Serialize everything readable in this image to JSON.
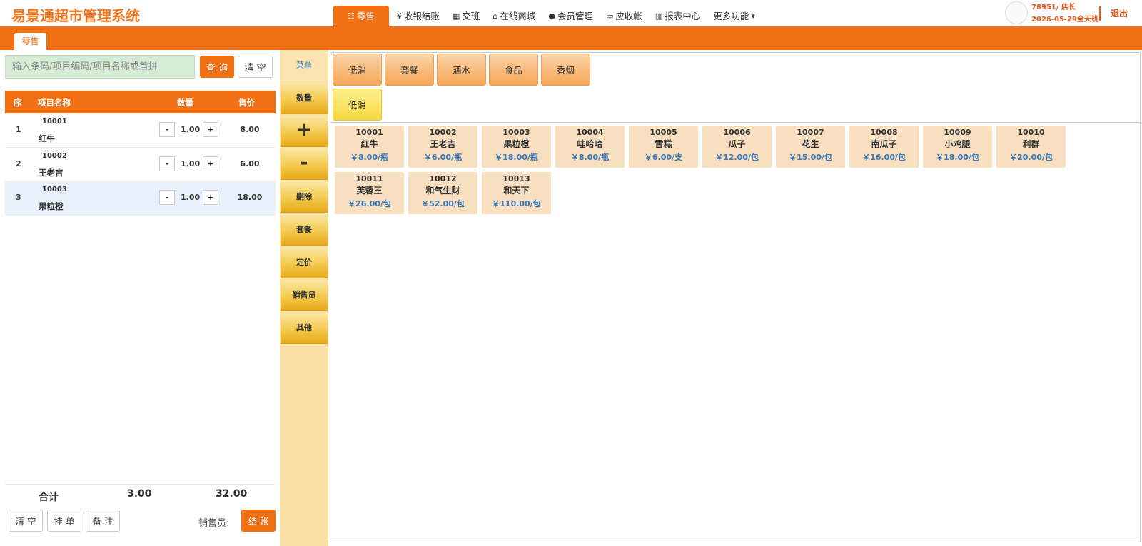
{
  "app": {
    "title": "易景通超市管理系统"
  },
  "nav": {
    "items": [
      {
        "label": "零售",
        "icon": "list-card-icon",
        "glyph": "☷"
      },
      {
        "label": "收银结账",
        "icon": "yen-icon",
        "glyph": "¥"
      },
      {
        "label": "交班",
        "icon": "calculator-icon",
        "glyph": "▦"
      },
      {
        "label": "在线商城",
        "icon": "basket-icon",
        "glyph": "⌂"
      },
      {
        "label": "会员管理",
        "icon": "user-icon",
        "glyph": "●"
      },
      {
        "label": "应收帐",
        "icon": "credit-card-icon",
        "glyph": "▭"
      },
      {
        "label": "报表中心",
        "icon": "bar-chart-icon",
        "glyph": "▥"
      },
      {
        "label": "更多功能",
        "icon": "caret-down-icon",
        "glyph": "▾"
      }
    ]
  },
  "user": {
    "name": "78951/ 店长",
    "date": "2026-05-29全天班",
    "logout": "退出"
  },
  "tabs": {
    "retail": "零售"
  },
  "search": {
    "placeholder": "输入条码/项目编码/项目名称或首拼",
    "query": "查 询",
    "clear": "清 空"
  },
  "cart": {
    "headers": {
      "idx": "序",
      "name": "项目名称",
      "qty": "数量",
      "price": "售价"
    },
    "rows": [
      {
        "idx": "1",
        "code": "10001",
        "name": "红牛",
        "qty": "1.00",
        "price": "8.00",
        "minus": "-",
        "plus": "+"
      },
      {
        "idx": "2",
        "code": "10002",
        "name": "王老吉",
        "qty": "1.00",
        "price": "6.00",
        "minus": "-",
        "plus": "+"
      },
      {
        "idx": "3",
        "code": "10003",
        "name": "果粒橙",
        "qty": "1.00",
        "price": "18.00",
        "minus": "-",
        "plus": "+"
      }
    ],
    "total": {
      "label": "合计",
      "qty": "3.00",
      "amount": "32.00"
    }
  },
  "footer": {
    "clear": "清 空",
    "hold": "挂 单",
    "note": "备 注",
    "seller_label": "销售员:",
    "checkout": "结 账"
  },
  "tools": {
    "menu": "菜单",
    "qty": "数量",
    "add": "+",
    "sub": "-",
    "delete": "删除",
    "package": "套餐",
    "pricing": "定价",
    "seller": "销售员",
    "other": "其他"
  },
  "categories": [
    "低消",
    "套餐",
    "酒水",
    "食品",
    "香烟"
  ],
  "subcategories": [
    "低消"
  ],
  "products": [
    {
      "code": "10001",
      "name": "红牛",
      "price": "￥8.00/瓶"
    },
    {
      "code": "10002",
      "name": "王老吉",
      "price": "￥6.00/瓶"
    },
    {
      "code": "10003",
      "name": "果粒橙",
      "price": "￥18.00/瓶"
    },
    {
      "code": "10004",
      "name": "哇哈哈",
      "price": "￥8.00/瓶"
    },
    {
      "code": "10005",
      "name": "雪糕",
      "price": "￥6.00/支"
    },
    {
      "code": "10006",
      "name": "瓜子",
      "price": "￥12.00/包"
    },
    {
      "code": "10007",
      "name": "花生",
      "price": "￥15.00/包"
    },
    {
      "code": "10008",
      "name": "南瓜子",
      "price": "￥16.00/包"
    },
    {
      "code": "10009",
      "name": "小鸡腿",
      "price": "￥18.00/包"
    },
    {
      "code": "10010",
      "name": "利群",
      "price": "￥20.00/包"
    },
    {
      "code": "10011",
      "name": "芙蓉王",
      "price": "￥26.00/包"
    },
    {
      "code": "10012",
      "name": "和气生财",
      "price": "￥52.00/包"
    },
    {
      "code": "10013",
      "name": "和天下",
      "price": "￥110.00/包"
    }
  ],
  "colors": {
    "accent": "#f27014",
    "price": "#3a78b8",
    "search_bg": "#d7ecd4"
  }
}
